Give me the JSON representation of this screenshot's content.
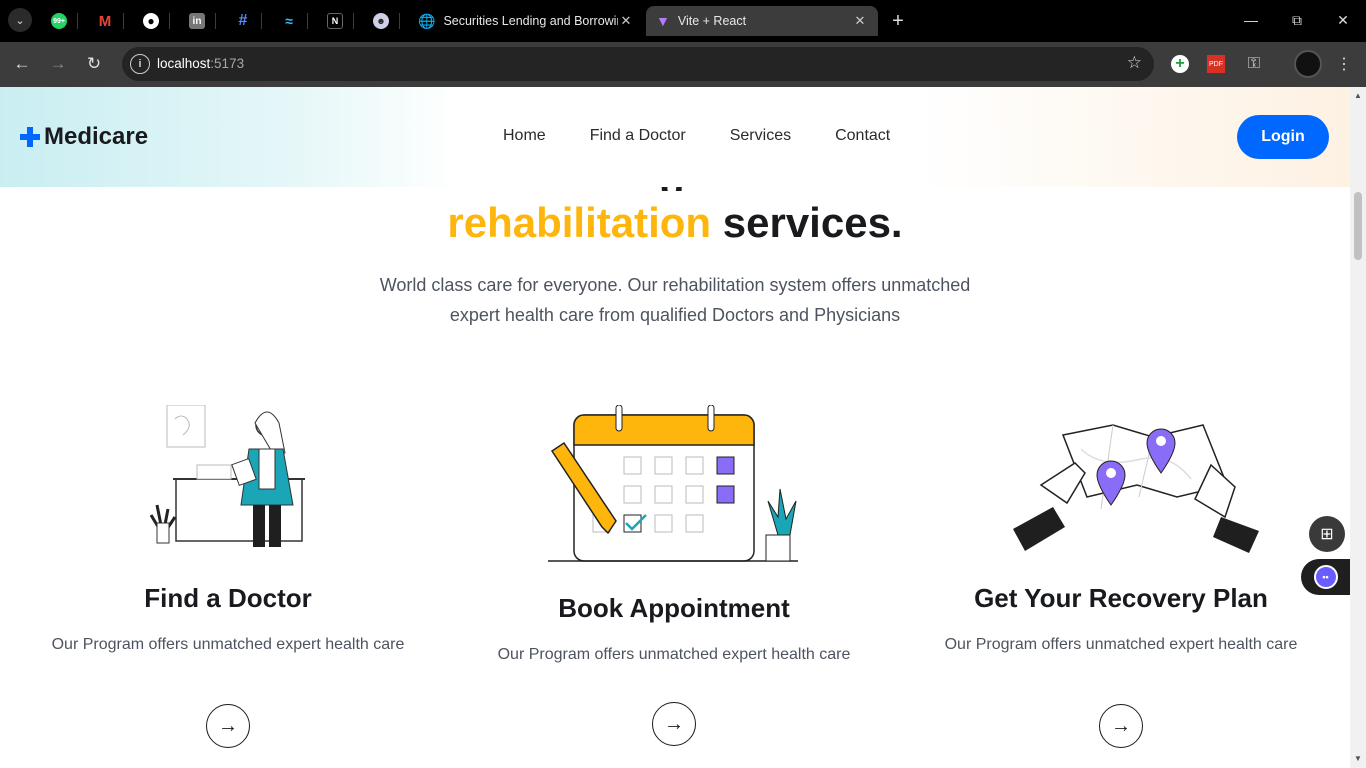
{
  "browser": {
    "tabs_menu_icon": "chevron-down",
    "pinned_tabs": [
      {
        "name": "whatsapp",
        "badge": "99+"
      },
      {
        "name": "gmail",
        "badge": ""
      },
      {
        "name": "github",
        "badge": ""
      },
      {
        "name": "linkedin",
        "badge": ""
      },
      {
        "name": "hashnode",
        "badge": ""
      },
      {
        "name": "tailwind",
        "badge": ""
      },
      {
        "name": "notion",
        "badge": ""
      },
      {
        "name": "discord",
        "badge": ""
      }
    ],
    "tabs": [
      {
        "title": "Securities Lending and Borrowing",
        "active": false
      },
      {
        "title": "Vite + React",
        "active": true
      }
    ],
    "url_host": "localhost",
    "url_port": ":5173"
  },
  "header": {
    "logo": "Medicare",
    "nav": [
      "Home",
      "Find a Doctor",
      "Services",
      "Contact"
    ],
    "login_label": "Login"
  },
  "hero": {
    "partial_line": "g",
    "highlight": "rehabilitation",
    "rest": "services.",
    "subtitle_line1": "World class care for everyone. Our rehabilitation system offers unmatched",
    "subtitle_line2": "expert health care from qualified Doctors and Physicians"
  },
  "cards": [
    {
      "title": "Find a Doctor",
      "desc": "Our Program offers unmatched expert health care",
      "icon": "doctor-illustration"
    },
    {
      "title": "Book Appointment",
      "desc": "Our Program offers unmatched expert health care",
      "icon": "calendar-illustration"
    },
    {
      "title": "Get Your Recovery Plan",
      "desc": "Our Program offers unmatched expert health care",
      "icon": "map-illustration"
    }
  ],
  "colors": {
    "brand": "#0067ff",
    "highlight": "#feb60d",
    "accent_purple": "#8b6cf6",
    "accent_teal": "#1aa6b7"
  }
}
